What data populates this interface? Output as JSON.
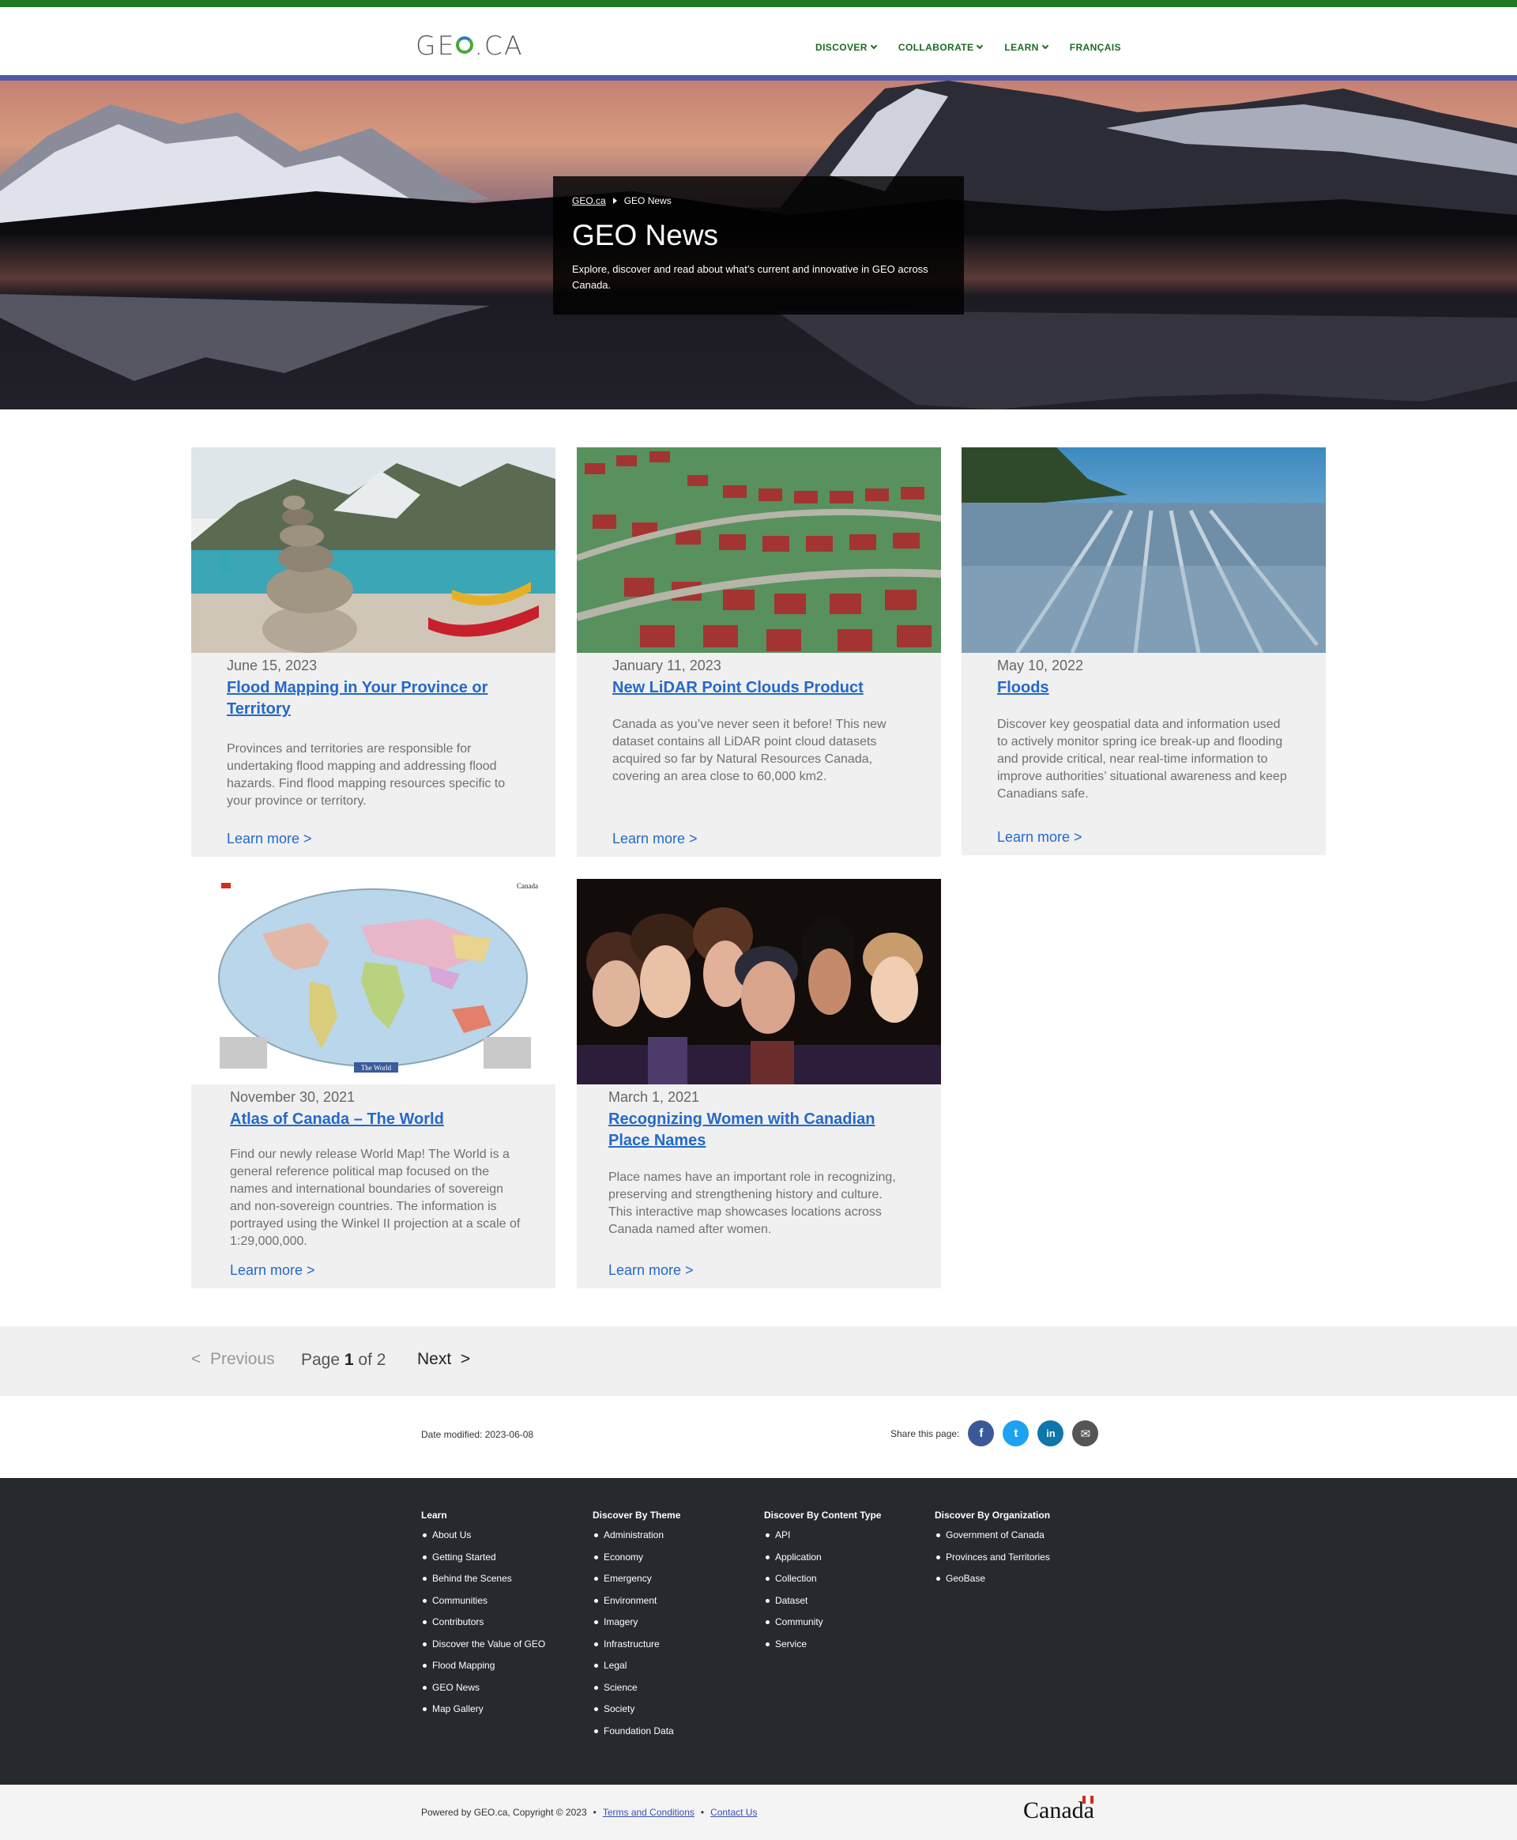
{
  "header": {
    "logo": "GEO.CA",
    "logo_parts": [
      "GE",
      "",
      ".CA"
    ],
    "nav": [
      {
        "label": "DISCOVER",
        "has_dropdown": true
      },
      {
        "label": "COLLABORATE",
        "has_dropdown": true
      },
      {
        "label": "LEARN",
        "has_dropdown": true
      },
      {
        "label": "FRANÇAIS",
        "has_dropdown": false
      }
    ]
  },
  "hero": {
    "breadcrumbs": [
      "GEO.ca",
      "GEO News"
    ],
    "title": "GEO News",
    "subtitle": "Explore, discover and read about what’s current and innovative in GEO across Canada."
  },
  "cards": [
    {
      "date": "June 15, 2023",
      "title": "Flood Mapping in Your Province or Territory",
      "description": "Provinces and territories are responsible for undertaking flood mapping and addressing flood hazards. Find flood mapping resources specific to your province or territory.",
      "link": "Learn more >",
      "image": "inukshuk-lake-photo"
    },
    {
      "date": "January 11, 2023",
      "title": "New LiDAR Point Clouds Product",
      "description": "Canada as you’ve never seen it before! This new dataset contains all LiDAR point cloud datasets acquired so far by Natural Resources Canada, covering an area close to 60,000 km2.",
      "link": "Learn more >",
      "image": "lidar-point-cloud-image"
    },
    {
      "date": "May 10, 2022",
      "title": "Floods",
      "description": "Discover key geospatial data and information used to actively monitor spring ice break-up and flooding and provide critical, near real-time information to improve authorities’ situational awareness and keep Canadians safe.",
      "link": "Learn more >",
      "image": "tidal-flats-photo"
    },
    {
      "date": "November 30, 2021",
      "title": "Atlas of Canada – The World",
      "description": "Find our newly release World Map! The World is a general reference political map focused on the names and international boundaries of sovereign and non-sovereign countries. The information is portrayed using the Winkel II projection at a scale of 1:29,000,000.",
      "link": "Learn more >",
      "image": "world-map-poster",
      "map_banner": "The World",
      "map_brand": "Canada"
    },
    {
      "date": "March 1, 2021",
      "title": "Recognizing Women with Canadian Place Names",
      "description": "Place names have an important role in recognizing, preserving and strengthening history and culture. This interactive map showcases locations across Canada named after women.",
      "link": "Learn more >",
      "image": "women-portraits-painting"
    }
  ],
  "pagination": {
    "previous": "Previous",
    "page_prefix": "Page",
    "current": "1",
    "page_suffix": "of 2",
    "next": "Next"
  },
  "meta": {
    "date_modified": "Date modified: 2023-06-08",
    "share_label": "Share this page:",
    "share_buttons": [
      {
        "name": "facebook",
        "glyph": "f",
        "color": "#3b5998"
      },
      {
        "name": "twitter",
        "glyph": "t",
        "color": "#1da1f2"
      },
      {
        "name": "linkedin",
        "glyph": "in",
        "color": "#0e76a8"
      },
      {
        "name": "email",
        "glyph": "✉",
        "color": "#555555"
      }
    ]
  },
  "footer": {
    "columns": [
      {
        "heading": "Learn",
        "items": [
          "About Us",
          "Getting Started",
          "Behind the Scenes",
          "Communities",
          "Contributors",
          "Discover the Value of GEO",
          "Flood Mapping",
          "GEO News",
          "Map Gallery"
        ]
      },
      {
        "heading": "Discover By Theme",
        "items": [
          "Administration",
          "Economy",
          "Emergency",
          "Environment",
          "Imagery",
          "Infrastructure",
          "Legal",
          "Science",
          "Society",
          "Foundation Data"
        ]
      },
      {
        "heading": "Discover By Content Type",
        "items": [
          "API",
          "Application",
          "Collection",
          "Dataset",
          "Community",
          "Service"
        ]
      },
      {
        "heading": "Discover By Organization",
        "items": [
          "Government of Canada",
          "Provinces and Territories",
          "GeoBase"
        ]
      }
    ],
    "copyright": "Powered by GEO.ca, Copyright © 2023",
    "separator": "•",
    "terms": "Terms and Conditions",
    "contact": "Contact Us",
    "wordmark": "Canada"
  }
}
